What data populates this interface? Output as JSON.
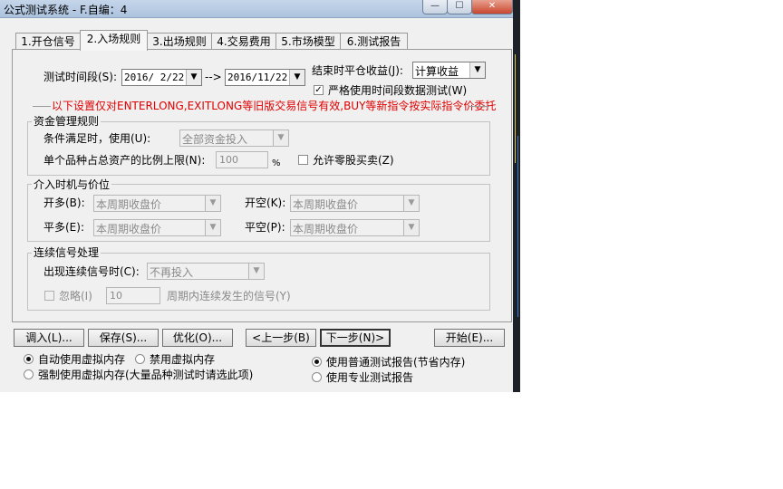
{
  "window": {
    "title": "公式测试系统 - F.自编：4",
    "minimize_icon": "minimize-icon",
    "maximize_icon": "maximize-icon",
    "close_icon": "close-icon"
  },
  "tabs": [
    {
      "label": "1.开仓信号"
    },
    {
      "label": "2.入场规则"
    },
    {
      "label": "3.出场规则"
    },
    {
      "label": "4.交易费用"
    },
    {
      "label": "5.市场模型"
    },
    {
      "label": "6.测试报告"
    }
  ],
  "period": {
    "label": "测试时间段(S):",
    "start": "2016/ 2/22",
    "separator": "-->",
    "end": "2016/11/22",
    "close_label": "结束时平仓收益(J):",
    "close_value": "计算收益",
    "strict_label": "严格使用时间段数据测试(W)",
    "strict_checked": "✓"
  },
  "notice": "以下设置仅对ENTERLONG,EXITLONG等旧版交易信号有效,BUY等新指令按实际指令价委托",
  "funds": {
    "title": "资金管理规则",
    "cond_label": "条件满足时，使用(U):",
    "cond_value": "全部资金投入",
    "ratio_label": "单个品种占总资产的比例上限(N):",
    "ratio_value": "100",
    "ratio_unit": "%",
    "odd_label": "允许零股买卖(Z)"
  },
  "entry": {
    "title": "介入时机与价位",
    "open_long_label": "开多(B):",
    "open_long_value": "本周期收盘价",
    "open_short_label": "开空(K):",
    "open_short_value": "本周期收盘价",
    "close_long_label": "平多(E):",
    "close_long_value": "本周期收盘价",
    "close_short_label": "平空(P):",
    "close_short_value": "本周期收盘价"
  },
  "consecutive": {
    "title": "连续信号处理",
    "label": "出现连续信号时(C):",
    "value": "不再投入",
    "ignore_label": "忽略(I)",
    "ignore_value": "10",
    "suffix": "周期内连续发生的信号(Y)"
  },
  "buttons": {
    "load": "调入(L)...",
    "save": "保存(S)...",
    "optimize": "优化(O)...",
    "prev": "<上一步(B)",
    "next": "下一步(N)>",
    "start": "开始(E)..."
  },
  "memory": {
    "auto": "自动使用虚拟内存",
    "disable": "禁用虚拟内存",
    "force": "强制使用虚拟内存(大量品种测试时请选此项)",
    "normal_report": "使用普通测试报告(节省内存)",
    "pro_report": "使用专业测试报告"
  },
  "colors": {
    "notice": "#e00000",
    "titlebar": "#bcd0e6",
    "close": "#c9462d"
  }
}
